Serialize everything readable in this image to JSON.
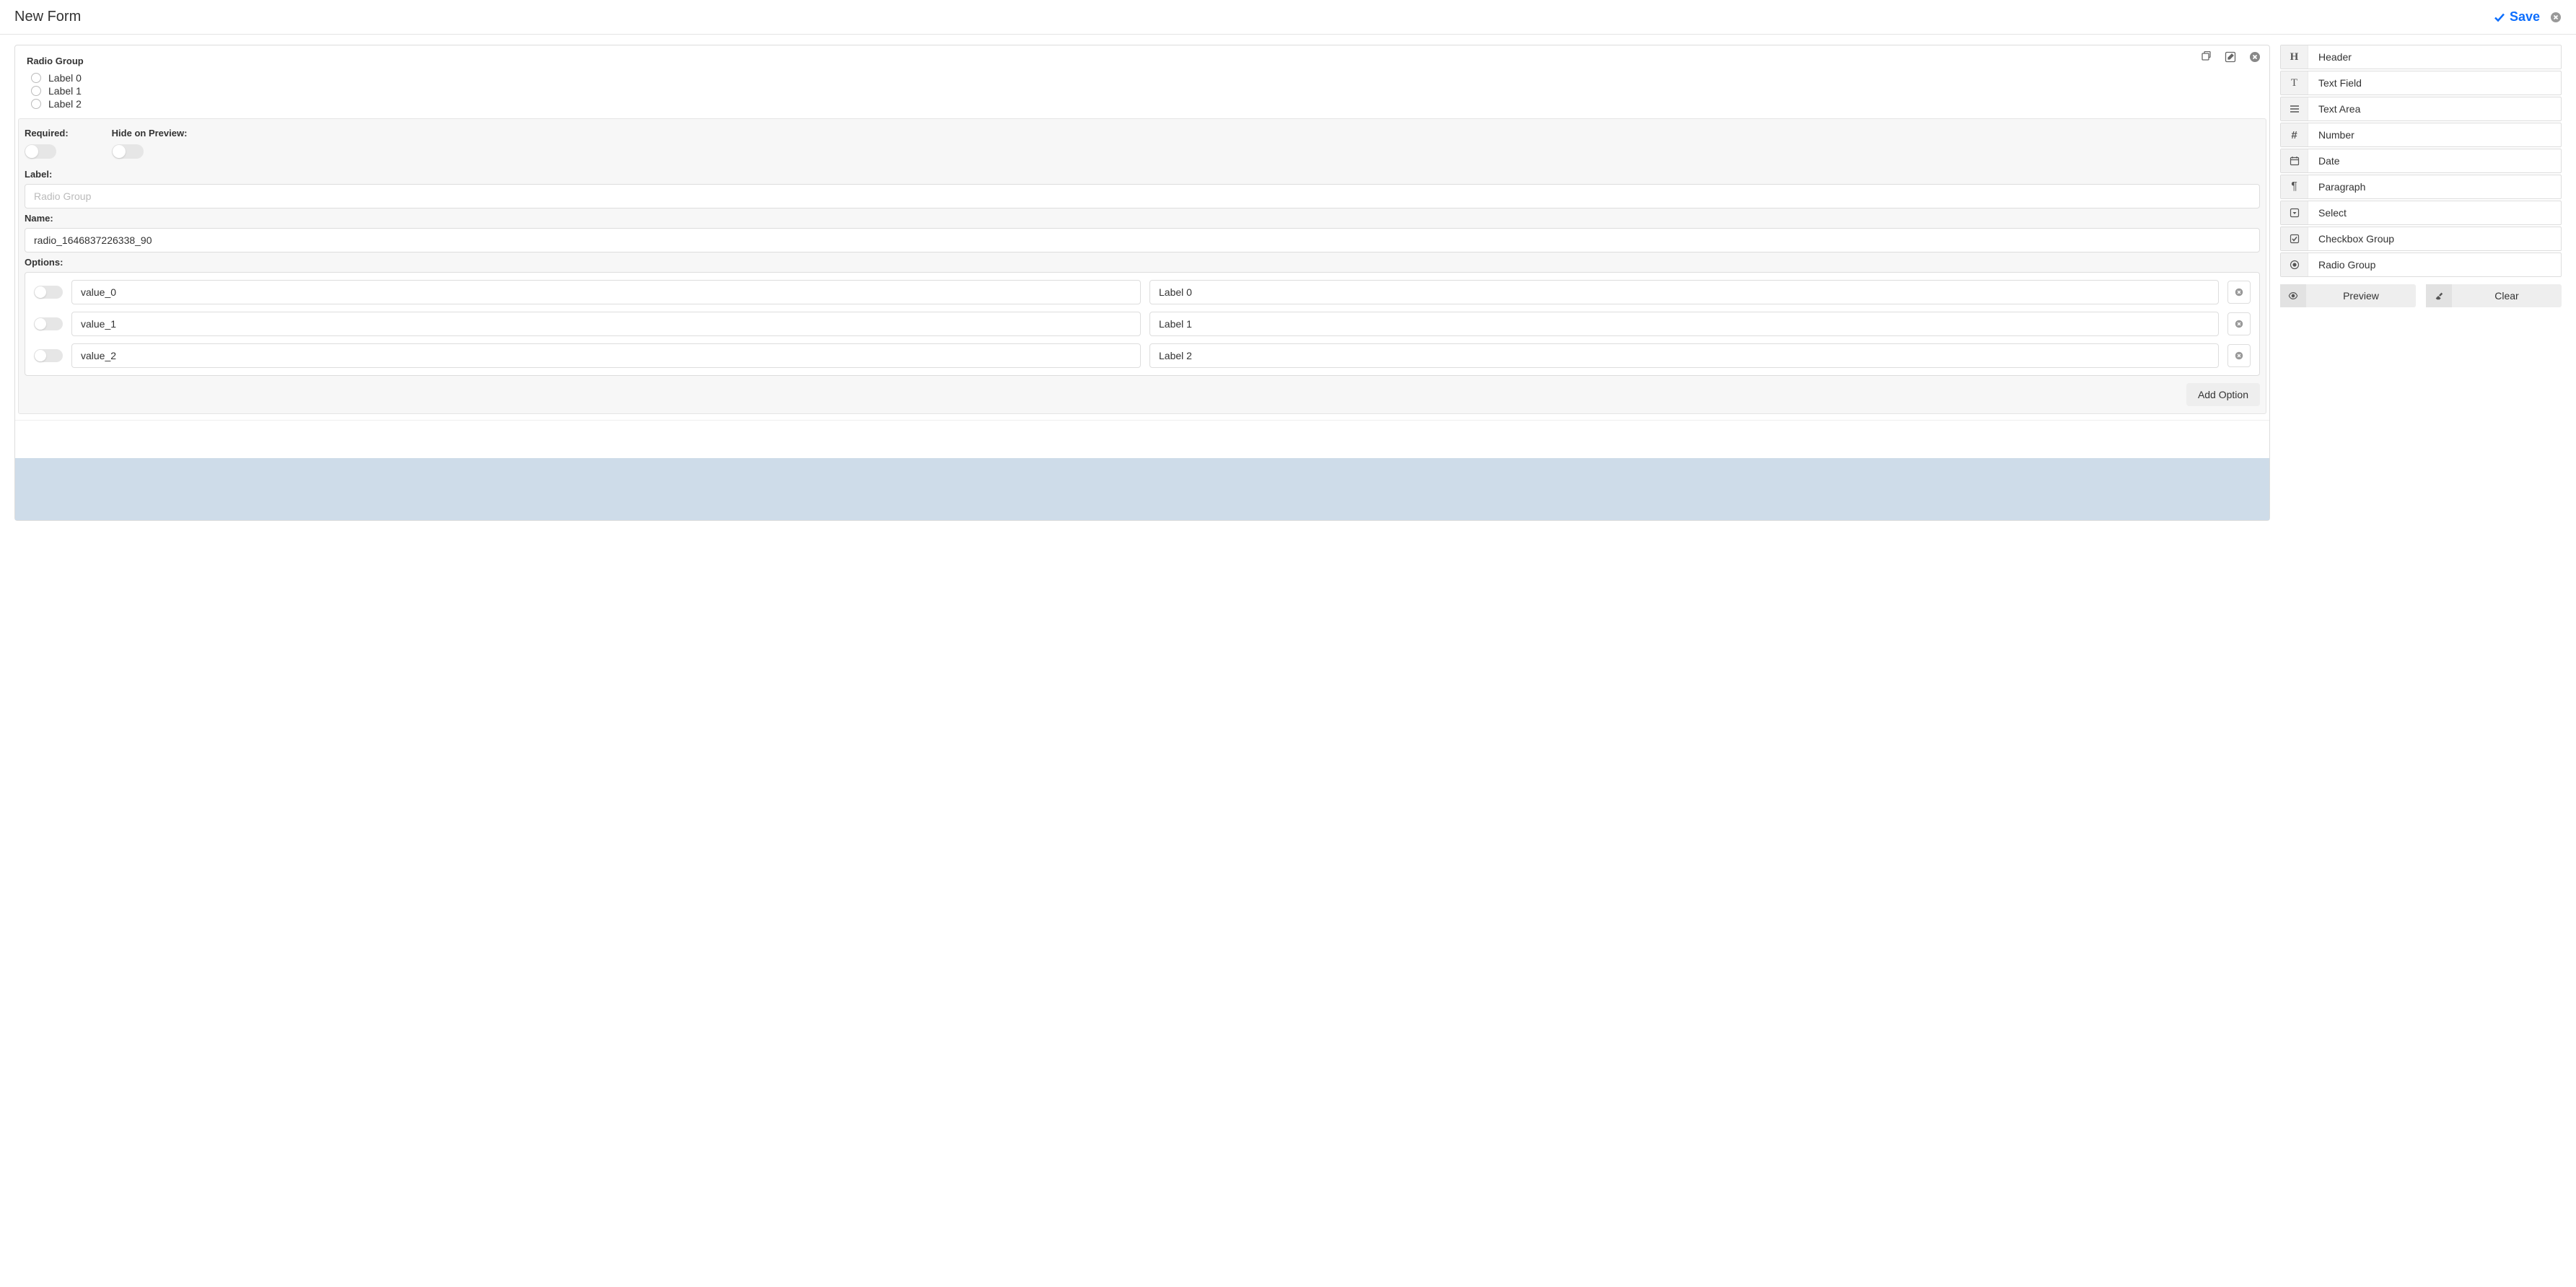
{
  "header": {
    "title": "New Form",
    "save_label": "Save"
  },
  "field": {
    "type_label": "Radio Group",
    "radio_items": [
      "Label 0",
      "Label 1",
      "Label 2"
    ]
  },
  "editor": {
    "required_label": "Required:",
    "hide_label": "Hide on Preview:",
    "label_label": "Label:",
    "label_placeholder": "Radio Group",
    "name_label": "Name:",
    "name_value": "radio_1646837226338_90",
    "options_label": "Options:",
    "options": [
      {
        "value": "value_0",
        "label": "Label 0"
      },
      {
        "value": "value_1",
        "label": "Label 1"
      },
      {
        "value": "value_2",
        "label": "Label 2"
      }
    ],
    "add_option_label": "Add Option"
  },
  "palette": [
    {
      "icon": "heading",
      "label": "Header"
    },
    {
      "icon": "text",
      "label": "Text Field"
    },
    {
      "icon": "lines",
      "label": "Text Area"
    },
    {
      "icon": "hash",
      "label": "Number"
    },
    {
      "icon": "calendar",
      "label": "Date"
    },
    {
      "icon": "pilcrow",
      "label": "Paragraph"
    },
    {
      "icon": "caretbox",
      "label": "Select"
    },
    {
      "icon": "check",
      "label": "Checkbox Group"
    },
    {
      "icon": "dot",
      "label": "Radio Group"
    }
  ],
  "sidebar_actions": {
    "preview_label": "Preview",
    "clear_label": "Clear"
  }
}
